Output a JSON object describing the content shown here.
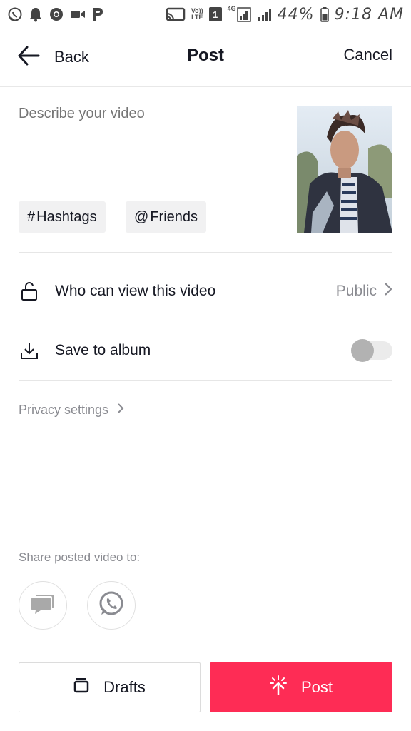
{
  "status_bar": {
    "battery_text": "44%",
    "time": "9:18 AM",
    "volte_top": "Vo))",
    "volte_bottom": "LTE",
    "sim": "1",
    "network": "4G"
  },
  "header": {
    "back_label": "Back",
    "title": "Post",
    "cancel_label": "Cancel"
  },
  "description": {
    "placeholder": "Describe your video"
  },
  "chips": {
    "hashtags_symbol": "#",
    "hashtags_label": "Hashtags",
    "friends_symbol": "@",
    "friends_label": "Friends"
  },
  "settings": {
    "who_can_view_label": "Who can view this video",
    "who_can_view_value": "Public",
    "save_to_album_label": "Save to album",
    "save_to_album_on": false
  },
  "privacy_settings_label": "Privacy settings",
  "share": {
    "label": "Share posted video to:",
    "targets": [
      "message-icon",
      "whatsapp-icon"
    ]
  },
  "footer": {
    "drafts_label": "Drafts",
    "post_label": "Post"
  },
  "colors": {
    "accent": "#fe2c55",
    "text_primary": "#161823",
    "text_secondary": "#8a8b91"
  }
}
